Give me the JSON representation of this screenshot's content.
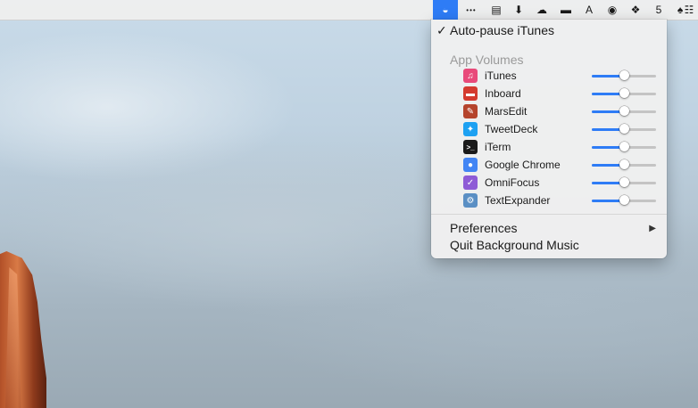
{
  "menubar": {
    "icons": [
      {
        "name": "background-music-icon",
        "glyph": "◒"
      },
      {
        "name": "more-dots-icon",
        "glyph": "•••"
      },
      {
        "name": "top-hat-icon",
        "glyph": "▤"
      },
      {
        "name": "download-box-icon",
        "glyph": "⬇"
      },
      {
        "name": "cloud-app-icon",
        "glyph": "☁"
      },
      {
        "name": "toolbox-icon",
        "glyph": "▬"
      },
      {
        "name": "a-logo-icon",
        "glyph": "A"
      },
      {
        "name": "sync-circle-icon",
        "glyph": "◉"
      },
      {
        "name": "dropbox-icon",
        "glyph": "❖"
      },
      {
        "name": "html5-shield-icon",
        "glyph": "5"
      },
      {
        "name": "broom-icon",
        "glyph": "♠"
      },
      {
        "name": "clipboard-icon",
        "glyph": "☷"
      }
    ]
  },
  "menu": {
    "auto_pause": {
      "check": "✓",
      "label": "Auto-pause iTunes"
    },
    "section_label": "App Volumes",
    "apps": [
      {
        "name": "iTunes",
        "icon": "itunes-icon",
        "glyph": "♫",
        "color": "#e84a7a",
        "volume": 0.5
      },
      {
        "name": "Inboard",
        "icon": "inboard-icon",
        "glyph": "▬",
        "color": "#d43a2f",
        "volume": 0.5
      },
      {
        "name": "MarsEdit",
        "icon": "marsedit-icon",
        "glyph": "✎",
        "color": "#b5442c",
        "volume": 0.5
      },
      {
        "name": "TweetDeck",
        "icon": "tweetdeck-icon",
        "glyph": "✦",
        "color": "#1da1f2",
        "volume": 0.5
      },
      {
        "name": "iTerm",
        "icon": "iterm-icon",
        "glyph": ">_",
        "color": "#1a1a1a",
        "volume": 0.5
      },
      {
        "name": "Google Chrome",
        "icon": "chrome-icon",
        "glyph": "●",
        "color": "#4285f4",
        "volume": 0.5
      },
      {
        "name": "OmniFocus",
        "icon": "omnifocus-icon",
        "glyph": "✓",
        "color": "#8e5bd6",
        "volume": 0.5
      },
      {
        "name": "TextExpander",
        "icon": "textexpander-icon",
        "glyph": "⚙",
        "color": "#5a8fc4",
        "volume": 0.5
      }
    ],
    "preferences": {
      "label": "Preferences",
      "arrow": "▶"
    },
    "quit": {
      "label": "Quit Background Music"
    }
  },
  "colors": {
    "accent": "#2e7cf6",
    "track": "#c4c4c4"
  }
}
